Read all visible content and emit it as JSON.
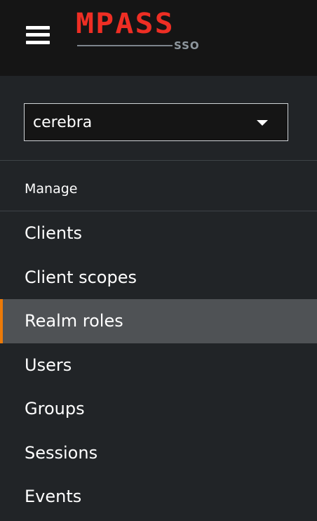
{
  "header": {
    "menu_icon": "hamburger-menu-icon",
    "logo": {
      "name": "MPASS",
      "sub": "SSO",
      "color": "#ee2e24"
    }
  },
  "realm_selector": {
    "value": "cerebra",
    "icon": "caret-down-icon"
  },
  "section": {
    "title": "Manage"
  },
  "nav": {
    "active_color": "#ec7a08",
    "items": [
      {
        "label": "Clients"
      },
      {
        "label": "Client scopes"
      },
      {
        "label": "Realm roles"
      },
      {
        "label": "Users"
      },
      {
        "label": "Groups"
      },
      {
        "label": "Sessions"
      },
      {
        "label": "Events"
      }
    ]
  }
}
